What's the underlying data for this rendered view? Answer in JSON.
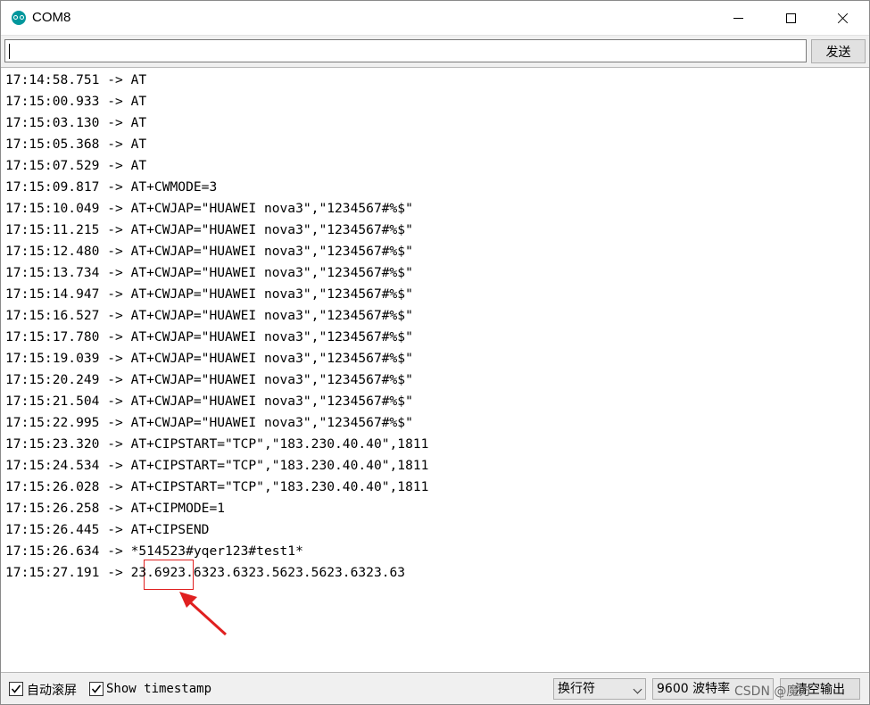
{
  "window": {
    "title": "COM8"
  },
  "send": {
    "input_value": "",
    "button_label": "发送"
  },
  "output_lines": [
    "17:14:58.751 -> AT",
    "17:15:00.933 -> AT",
    "17:15:03.130 -> AT",
    "17:15:05.368 -> AT",
    "17:15:07.529 -> AT",
    "17:15:09.817 -> AT+CWMODE=3",
    "17:15:10.049 -> AT+CWJAP=\"HUAWEI nova3\",\"1234567#%$\"",
    "17:15:11.215 -> AT+CWJAP=\"HUAWEI nova3\",\"1234567#%$\"",
    "17:15:12.480 -> AT+CWJAP=\"HUAWEI nova3\",\"1234567#%$\"",
    "17:15:13.734 -> AT+CWJAP=\"HUAWEI nova3\",\"1234567#%$\"",
    "17:15:14.947 -> AT+CWJAP=\"HUAWEI nova3\",\"1234567#%$\"",
    "17:15:16.527 -> AT+CWJAP=\"HUAWEI nova3\",\"1234567#%$\"",
    "17:15:17.780 -> AT+CWJAP=\"HUAWEI nova3\",\"1234567#%$\"",
    "17:15:19.039 -> AT+CWJAP=\"HUAWEI nova3\",\"1234567#%$\"",
    "17:15:20.249 -> AT+CWJAP=\"HUAWEI nova3\",\"1234567#%$\"",
    "17:15:21.504 -> AT+CWJAP=\"HUAWEI nova3\",\"1234567#%$\"",
    "17:15:22.995 -> AT+CWJAP=\"HUAWEI nova3\",\"1234567#%$\"",
    "17:15:23.320 -> AT+CIPSTART=\"TCP\",\"183.230.40.40\",1811",
    "17:15:24.534 -> AT+CIPSTART=\"TCP\",\"183.230.40.40\",1811",
    "17:15:26.028 -> AT+CIPSTART=\"TCP\",\"183.230.40.40\",1811",
    "17:15:26.258 -> AT+CIPMODE=1",
    "17:15:26.445 -> AT+CIPSEND",
    "17:15:26.634 -> *514523#yqer123#test1*",
    "17:15:27.191 -> 23.6923.6323.6323.5623.5623.6323.63"
  ],
  "bottom": {
    "autoscroll_label": "自动滚屏",
    "autoscroll_checked": true,
    "timestamp_label": "Show timestamp",
    "timestamp_checked": true,
    "line_ending": "换行符",
    "baud": "9600 波特率",
    "clear_label": "清空输出",
    "watermark": "CSDN @魔方"
  }
}
